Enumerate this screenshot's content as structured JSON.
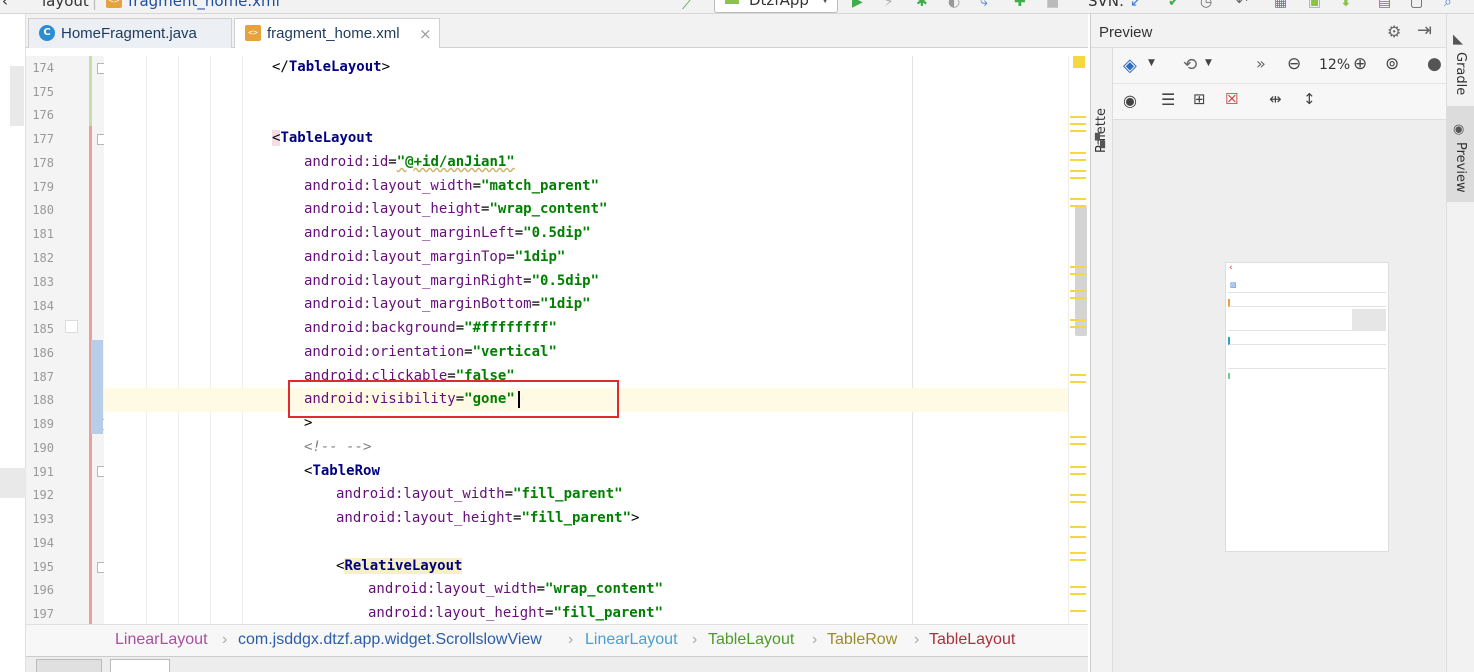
{
  "top_strip": {
    "breadcrumb_layout": "layout",
    "breadcrumb_file": "fragment_home.xml",
    "run_config": "DtzfApp",
    "svn_label": "SVN:"
  },
  "tabs": [
    {
      "label": "HomeFragment.java",
      "icon": "java-class-icon",
      "active": false
    },
    {
      "label": "fragment_home.xml",
      "icon": "xml-file-icon",
      "active": true
    }
  ],
  "gutter": {
    "line_numbers": [
      "174",
      "175",
      "176",
      "177",
      "178",
      "179",
      "180",
      "181",
      "182",
      "183",
      "184",
      "185",
      "186",
      "187",
      "188",
      "189",
      "190",
      "191",
      "192",
      "193",
      "194",
      "195",
      "196",
      "197"
    ]
  },
  "code": {
    "l174_tag": "TableLayout",
    "l177_tag": "TableLayout",
    "l178_attr": "android:id",
    "l178_val": "\"@+id/anJian1\"",
    "l179_attr": "android:layout_width",
    "l179_val": "\"match_parent\"",
    "l180_attr": "android:layout_height",
    "l180_val": "\"wrap_content\"",
    "l181_attr": "android:layout_marginLeft",
    "l181_val": "\"0.5dip\"",
    "l182_attr": "android:layout_marginTop",
    "l182_val": "\"1dip\"",
    "l183_attr": "android:layout_marginRight",
    "l183_val": "\"0.5dip\"",
    "l184_attr": "android:layout_marginBottom",
    "l184_val": "\"1dip\"",
    "l185_attr": "android:background",
    "l185_val": "\"#ffffffff\"",
    "l186_attr": "android:orientation",
    "l186_val": "\"vertical\"",
    "l187_attr": "android:clickable",
    "l187_val": "\"false\"",
    "l188_attr": "android:visibility",
    "l188_val_open": "\"gone",
    "l188_val_close": "\"",
    "l189_close": ">",
    "l190_comment": "<!-- -->",
    "l191_tag": "TableRow",
    "l192_attr": "android:layout_width",
    "l192_val": "\"fill_parent\"",
    "l193_attr": "android:layout_height",
    "l193_val": "\"fill_parent\"",
    "l195_tag": "RelativeLayout",
    "l196_attr": "android:layout_width",
    "l196_val": "\"wrap_content\"",
    "l197_attr": "android:layout_height",
    "l197_val": "\"fill_parent\""
  },
  "breadcrumb": [
    {
      "label": "LinearLayout",
      "color": "#a94fa0"
    },
    {
      "label": "com.jsddgx.dtzf.app.widget.ScrollslowView",
      "color": "#2b5ea8"
    },
    {
      "label": "LinearLayout",
      "color": "#4a9fd1"
    },
    {
      "label": "TableLayout",
      "color": "#4e9a2b"
    },
    {
      "label": "TableRow",
      "color": "#9a8b2b"
    },
    {
      "label": "TableLayout",
      "color": "#a8323c"
    }
  ],
  "preview": {
    "title": "Preview",
    "palette_label": "Palette",
    "zoom": "12%"
  },
  "right_strip": {
    "gradle_label": "Gradle",
    "preview_label": "Preview"
  },
  "colors": {
    "highlight_box": "#e02b2b",
    "caret_line": "#fffae3",
    "tag_highlight": "#f7f0c4",
    "value_green": "#008000",
    "attribute_purple": "#660e7a"
  }
}
